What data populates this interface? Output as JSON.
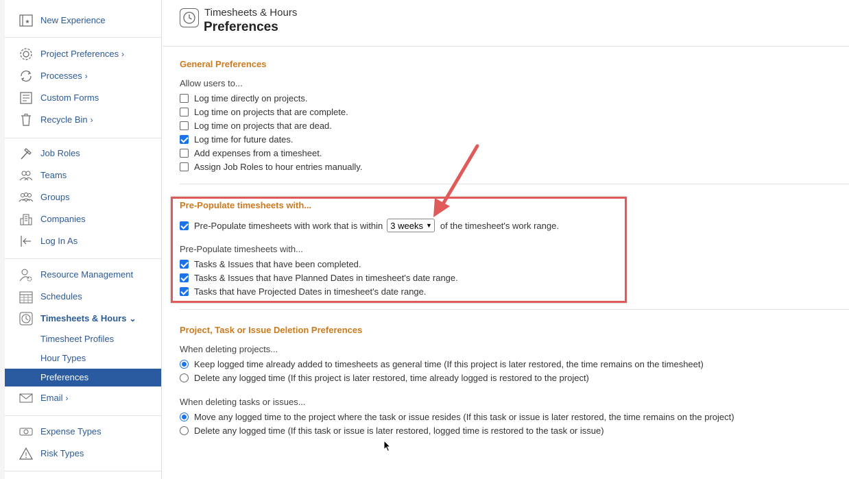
{
  "sidebar": {
    "items": [
      {
        "label": "New Experience",
        "chev": ""
      },
      {
        "label": "Project Preferences",
        "chev": "›"
      },
      {
        "label": "Processes",
        "chev": "›"
      },
      {
        "label": "Custom Forms",
        "chev": ""
      },
      {
        "label": "Recycle Bin",
        "chev": "›"
      },
      {
        "label": "Job Roles",
        "chev": ""
      },
      {
        "label": "Teams",
        "chev": ""
      },
      {
        "label": "Groups",
        "chev": ""
      },
      {
        "label": "Companies",
        "chev": ""
      },
      {
        "label": "Log In As",
        "chev": ""
      },
      {
        "label": "Resource Management",
        "chev": ""
      },
      {
        "label": "Schedules",
        "chev": ""
      },
      {
        "label": "Timesheets & Hours",
        "chev": "⌄"
      },
      {
        "label": "Email",
        "chev": "›"
      },
      {
        "label": "Expense Types",
        "chev": ""
      },
      {
        "label": "Risk Types",
        "chev": ""
      }
    ],
    "sub_items": [
      {
        "label": "Timesheet Profiles"
      },
      {
        "label": "Hour Types"
      },
      {
        "label": "Preferences"
      }
    ]
  },
  "header": {
    "subtitle": "Timesheets & Hours",
    "title": "Preferences"
  },
  "general": {
    "title": "General Preferences",
    "intro": "Allow users to...",
    "options": [
      {
        "label": "Log time directly on projects.",
        "checked": false
      },
      {
        "label": "Log time on projects that are complete.",
        "checked": false
      },
      {
        "label": "Log time on projects that are dead.",
        "checked": false
      },
      {
        "label": "Log time for future dates.",
        "checked": true
      },
      {
        "label": "Add expenses from a timesheet.",
        "checked": false
      },
      {
        "label": "Assign Job Roles to hour entries manually.",
        "checked": false
      }
    ]
  },
  "prepopulate": {
    "title": "Pre-Populate timesheets with...",
    "within_before": "Pre-Populate timesheets with work that is within",
    "within_value": "3 weeks",
    "within_after": "of the timesheet's work range.",
    "within_checked": true,
    "sub_intro": "Pre-Populate timesheets with...",
    "options": [
      {
        "label": "Tasks & Issues that have been completed.",
        "checked": true
      },
      {
        "label": "Tasks & Issues that have Planned Dates in timesheet's date range.",
        "checked": true
      },
      {
        "label": "Tasks that have Projected Dates in timesheet's date range.",
        "checked": true
      }
    ]
  },
  "deletion": {
    "title": "Project, Task or Issue Deletion Preferences",
    "projects_intro": "When deleting projects...",
    "projects_options": [
      {
        "label": "Keep logged time already added to timesheets as general time (If this project is later restored, the time remains on the timesheet)",
        "checked": true
      },
      {
        "label": "Delete any logged time (If this project is later restored, time already logged is restored to the project)",
        "checked": false
      }
    ],
    "tasks_intro": "When deleting tasks or issues...",
    "tasks_options": [
      {
        "label": "Move any logged time to the project where the task or issue resides (If this task or issue is later restored, the time remains on the project)",
        "checked": true
      },
      {
        "label": "Delete any logged time (If this task or issue is later restored, logged time is restored to the task or issue)",
        "checked": false
      }
    ]
  },
  "colors": {
    "accent": "#cc7a1d",
    "link": "#2c5a96",
    "active_bg": "#2a5aa0",
    "highlight": "#e05a5a",
    "check": "#1a73e8"
  }
}
